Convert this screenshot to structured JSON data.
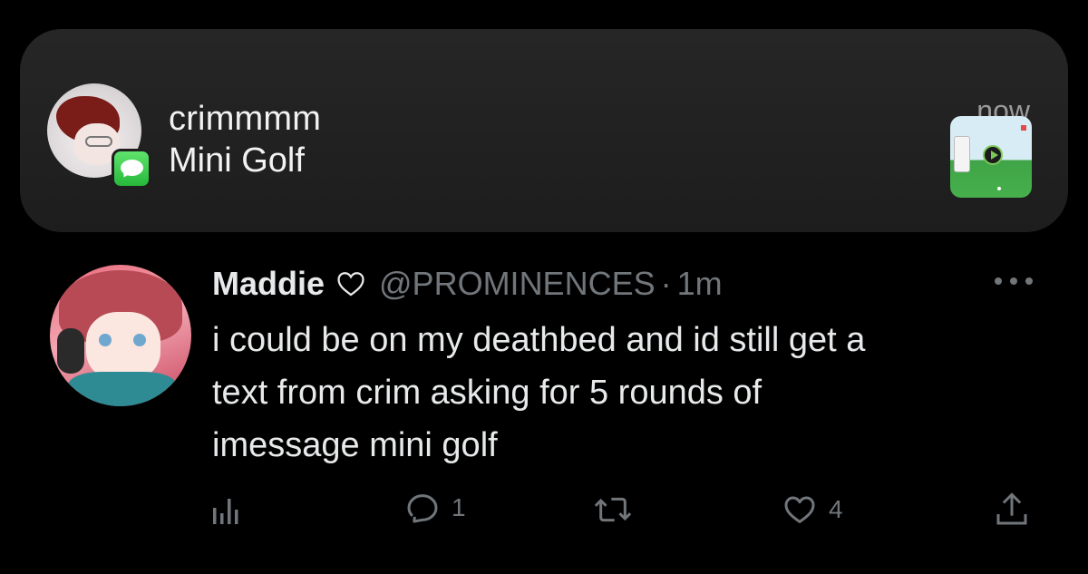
{
  "notification": {
    "sender": "crimmmm",
    "body": "Mini Golf",
    "time": "now",
    "app_badge_icon": "messages-app-icon",
    "thumbnail_icon": "mini-golf-game-thumbnail"
  },
  "tweet": {
    "display_name": "Maddie",
    "handle": "@PROMINENCES",
    "separator": "·",
    "time": "1m",
    "text_lines": [
      "i could be on my deathbed and id still get a",
      "text from crim asking for 5 rounds of",
      "imessage mini golf"
    ],
    "actions": {
      "views_icon": "analytics-icon",
      "replies": "1",
      "retweets": "",
      "likes": "4",
      "share_icon": "share-icon"
    }
  },
  "colors": {
    "background": "#000000",
    "banner": "#222222",
    "text_primary": "#e7e9ea",
    "text_secondary": "#71767b",
    "messages_green": "#34c759"
  }
}
